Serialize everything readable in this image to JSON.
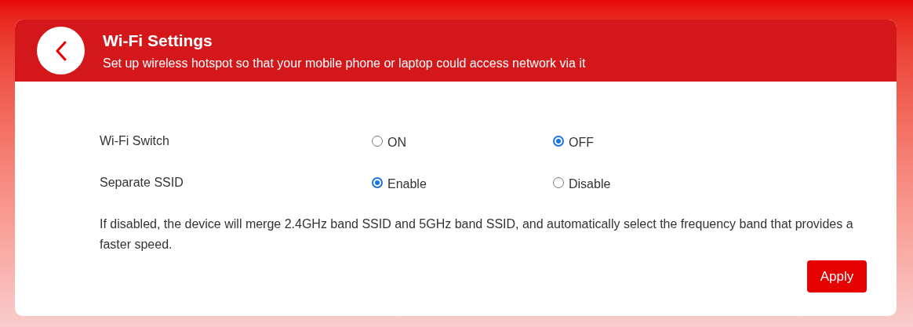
{
  "header": {
    "title": "Wi-Fi Settings",
    "subtitle": "Set up wireless hotspot so that your mobile phone or laptop could access network via it"
  },
  "settings": [
    {
      "label": "Wi-Fi Switch",
      "options": [
        {
          "label": "ON",
          "selected": false
        },
        {
          "label": "OFF",
          "selected": true
        }
      ]
    },
    {
      "label": "Separate SSID",
      "options": [
        {
          "label": "Enable",
          "selected": true
        },
        {
          "label": "Disable",
          "selected": false
        }
      ]
    }
  ],
  "note": "If disabled, the device will merge 2.4GHz band SSID and 5GHz band SSID, and automatically select the frequency band that provides a faster speed.",
  "apply_button": "Apply"
}
